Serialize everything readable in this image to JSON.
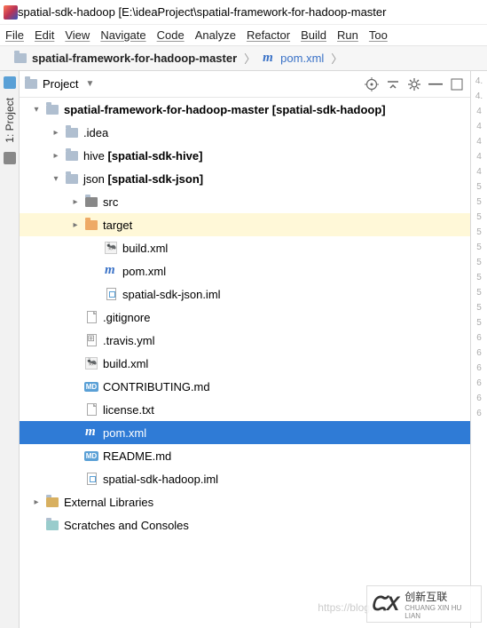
{
  "title": "spatial-sdk-hadoop [E:\\ideaProject\\spatial-framework-for-hadoop-master",
  "menu": {
    "file": "File",
    "edit": "Edit",
    "view": "View",
    "navigate": "Navigate",
    "code": "Code",
    "analyze": "Analyze",
    "refactor": "Refactor",
    "build": "Build",
    "run": "Run",
    "tools": "Too"
  },
  "breadcrumb": {
    "root": "spatial-framework-for-hadoop-master",
    "pom": "pom.xml"
  },
  "sideTab": {
    "project": "1: Project"
  },
  "panel": {
    "title": "Project"
  },
  "tree": {
    "root_name": "spatial-framework-for-hadoop-master",
    "root_suffix": "[spatial-sdk-hadoop]",
    "idea": ".idea",
    "hive": "hive",
    "hive_suffix": "[spatial-sdk-hive]",
    "json": "json",
    "json_suffix": "[spatial-sdk-json]",
    "src": "src",
    "target": "target",
    "json_build": "build.xml",
    "json_pom": "pom.xml",
    "json_iml": "spatial-sdk-json.iml",
    "gitignore": ".gitignore",
    "travis": ".travis.yml",
    "build": "build.xml",
    "contrib": "CONTRIBUTING.md",
    "license": "license.txt",
    "pom": "pom.xml",
    "readme": "README.md",
    "root_iml": "spatial-sdk-hadoop.iml",
    "extlib": "External Libraries",
    "scratches": "Scratches and Consoles"
  },
  "gutter": [
    "4.",
    "4.",
    "4",
    "4",
    "4",
    "4",
    "4",
    "5",
    "5",
    "5",
    "5",
    "5",
    "5",
    "5",
    "5",
    "5",
    "5",
    "6",
    "6",
    "6",
    "6",
    "6",
    "6"
  ],
  "watermark": {
    "big": "创新互联",
    "small": "CHUANG XIN HU LIAN"
  },
  "ghost": "https://blog.csd"
}
